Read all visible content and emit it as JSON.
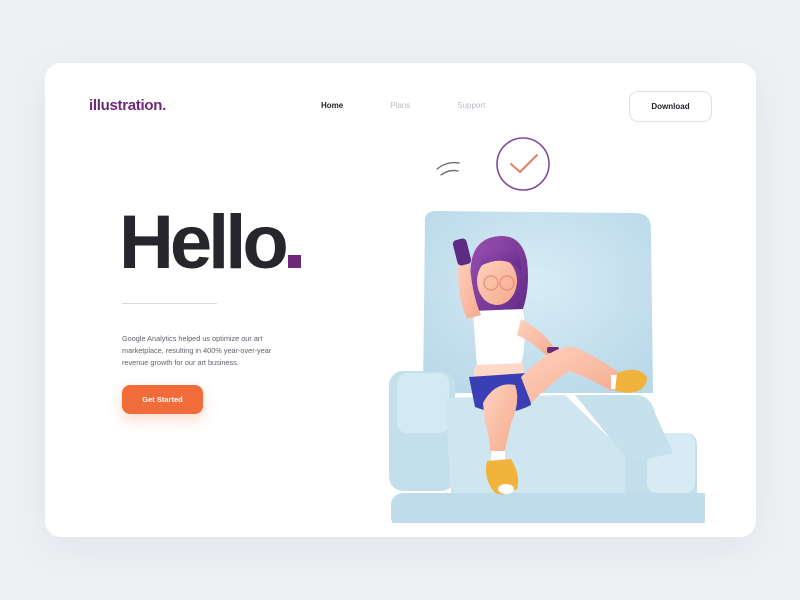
{
  "brand": {
    "logo_text": "illustration."
  },
  "nav": {
    "items": [
      {
        "label": "Home",
        "state": "active"
      },
      {
        "label": "Plans",
        "state": "inactive"
      },
      {
        "label": "Support",
        "state": "inactive"
      }
    ]
  },
  "header": {
    "download_label": "Download"
  },
  "hero": {
    "title": "Hello",
    "description": "Google Analytics helped us optimize our art marketplace, resulting in 400% year-over-year revenue growth for our art business.",
    "cta_label": "Get Started"
  },
  "colors": {
    "accent_purple": "#6e2a78",
    "cta_orange": "#f26b3a",
    "sofa_blue": "#c9e3ef",
    "background": "#eef1f4"
  },
  "icons": [
    "checkmark-circle-icon",
    "phone-signal-icon"
  ]
}
